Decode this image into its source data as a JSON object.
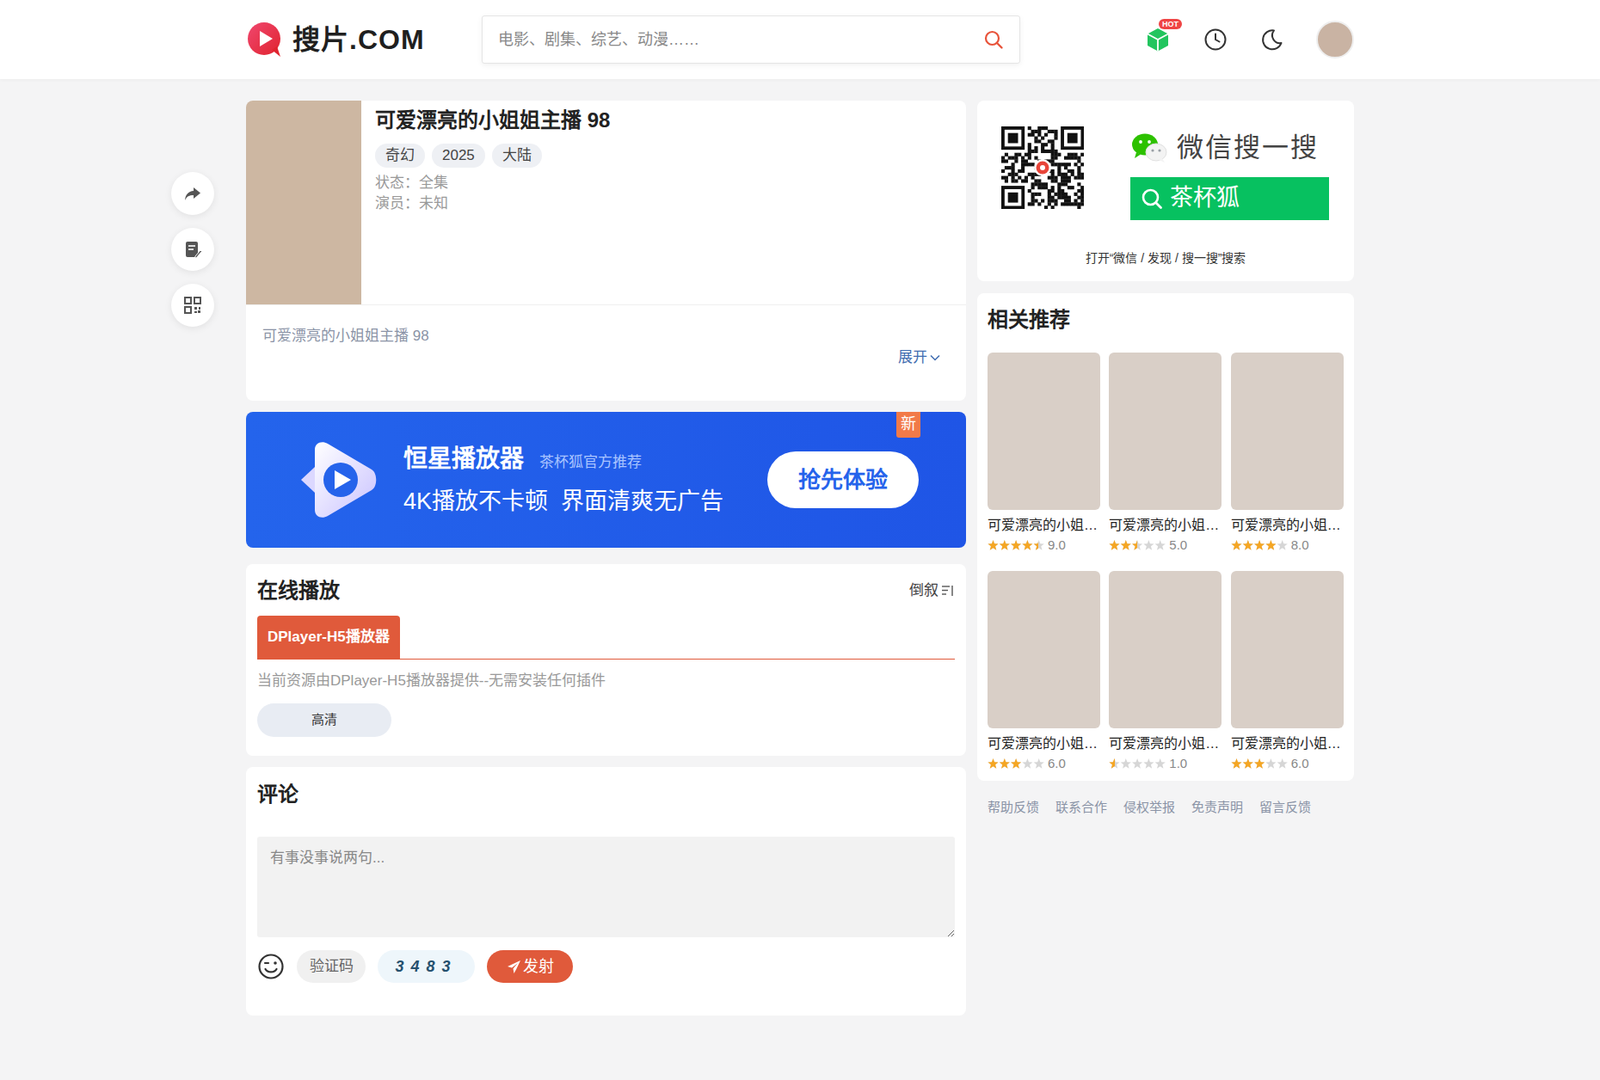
{
  "header": {
    "logo": "搜片.COM",
    "search": {
      "placeholder": "电影、剧集、综艺、动漫……"
    },
    "hot_badge": "HOT"
  },
  "detail": {
    "title": "可爱漂亮的小姐姐主播 98",
    "tags": [
      "奇幻",
      "2025",
      "大陆"
    ],
    "meta": [
      "状态：全集",
      "演员：未知"
    ],
    "description": "可爱漂亮的小姐姐主播 98",
    "expand": "展开"
  },
  "banner": {
    "name": "恒星播放器",
    "subtitle": "茶杯狐官方推荐",
    "slogan": "4K播放不卡顿  界面清爽无广告",
    "button": "抢先体验",
    "badge": "新"
  },
  "play": {
    "title": "在线播放",
    "sort": "倒叙",
    "sources": [
      {
        "label": "DPlayer-H5播放器",
        "selected": true
      }
    ],
    "note": "当前资源由DPlayer-H5播放器提供--无需安装任何插件",
    "episodes": [
      "高清"
    ]
  },
  "comments": {
    "title": "评论",
    "placeholder": "有事没事说两句...",
    "captcha_placeholder": "验证码",
    "captcha": "3483",
    "submit": "发射"
  },
  "wechat": {
    "brand": "微信搜一搜",
    "button": "茶杯狐",
    "hint": "打开“微信 / 发现 / 搜一搜”搜索"
  },
  "related": {
    "title": "相关推荐",
    "items": [
      {
        "title": "可爱漂亮的小姐…",
        "stars": 4.5,
        "score": "9.0"
      },
      {
        "title": "可爱漂亮的小姐…",
        "stars": 2.5,
        "score": "5.0"
      },
      {
        "title": "可爱漂亮的小姐…",
        "stars": 4,
        "score": "8.0"
      },
      {
        "title": "可爱漂亮的小姐…",
        "stars": 3,
        "score": "6.0"
      },
      {
        "title": "可爱漂亮的小姐…",
        "stars": 0.5,
        "score": "1.0"
      },
      {
        "title": "可爱漂亮的小姐…",
        "stars": 3,
        "score": "6.0"
      }
    ]
  },
  "footer_links": [
    "帮助反馈",
    "联系合作",
    "侵权举报",
    "免责声明",
    "留言反馈"
  ]
}
